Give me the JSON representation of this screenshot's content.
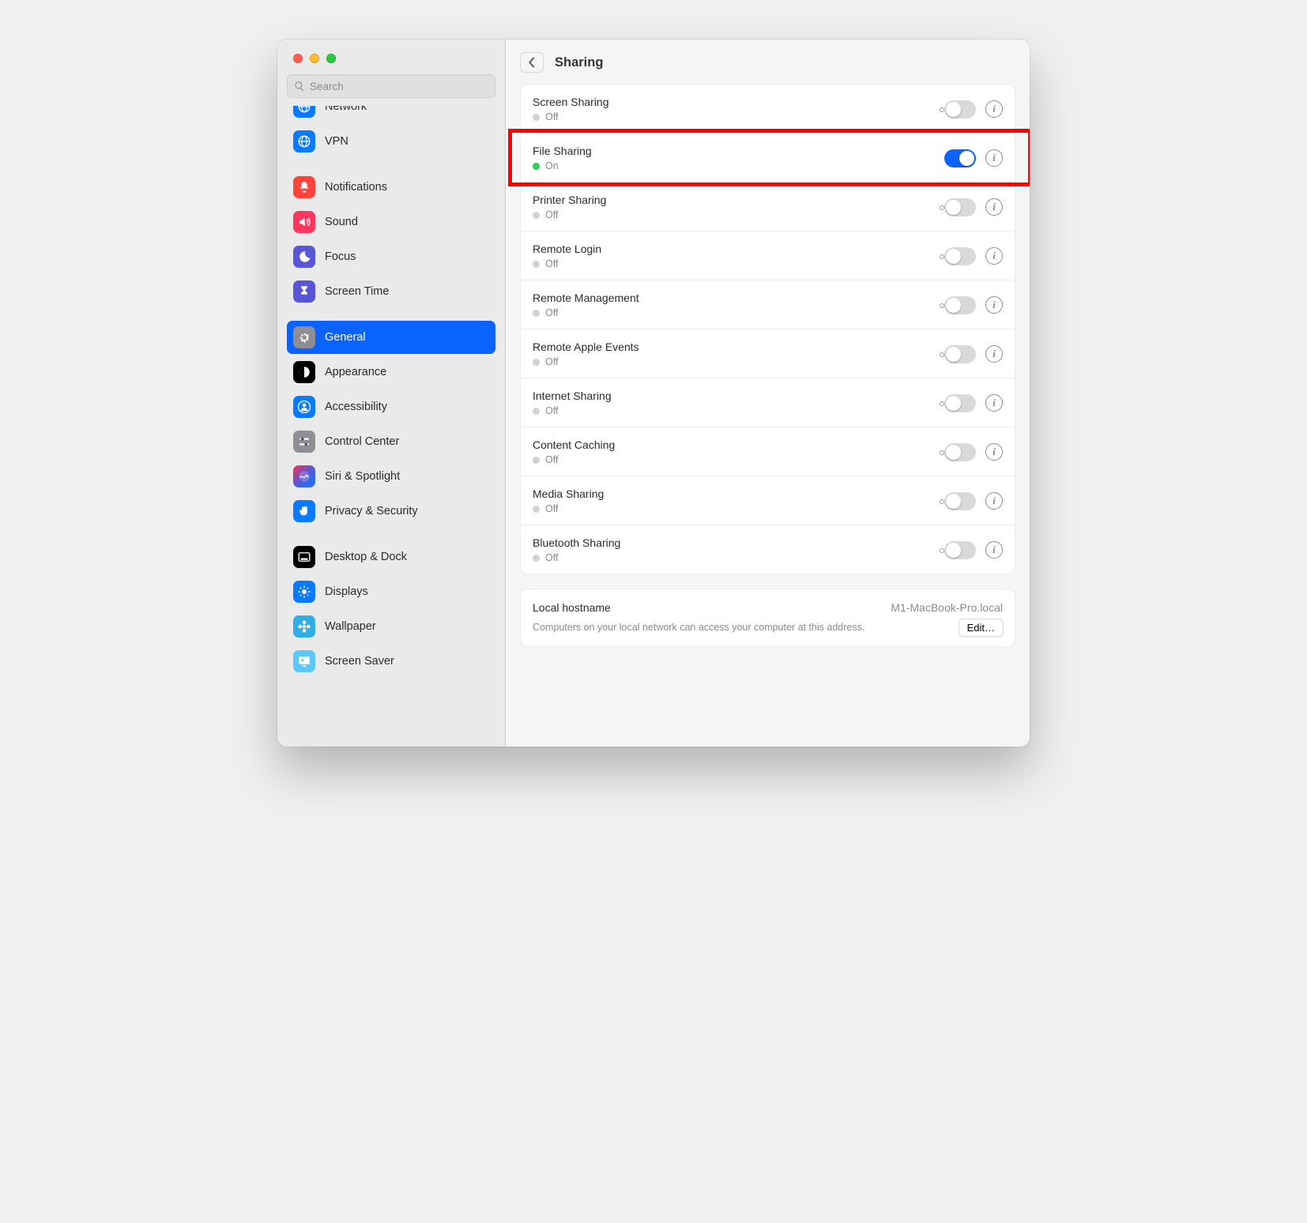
{
  "header": {
    "title": "Sharing"
  },
  "search": {
    "placeholder": "Search"
  },
  "sidebar": {
    "items": [
      {
        "label": "Network",
        "icon": "globe-grid-icon",
        "bg": "bg-blue",
        "partial": true
      },
      {
        "label": "VPN",
        "icon": "globe-grid-icon",
        "bg": "bg-blue2"
      },
      {
        "gap": true
      },
      {
        "label": "Notifications",
        "icon": "bell-icon",
        "bg": "bg-red"
      },
      {
        "label": "Sound",
        "icon": "sound-icon",
        "bg": "bg-pink"
      },
      {
        "label": "Focus",
        "icon": "moon-icon",
        "bg": "bg-indigo"
      },
      {
        "label": "Screen Time",
        "icon": "hourglass-icon",
        "bg": "bg-indigo"
      },
      {
        "gap": true
      },
      {
        "label": "General",
        "icon": "gear-icon",
        "bg": "bg-grey",
        "selected": true
      },
      {
        "label": "Appearance",
        "icon": "contrast-icon",
        "bg": "bg-black"
      },
      {
        "label": "Accessibility",
        "icon": "person-icon",
        "bg": "bg-blue"
      },
      {
        "label": "Control Center",
        "icon": "sliders-icon",
        "bg": "bg-grey"
      },
      {
        "label": "Siri & Spotlight",
        "icon": "siri-icon",
        "bg": "bg-siri"
      },
      {
        "label": "Privacy & Security",
        "icon": "hand-icon",
        "bg": "bg-blue"
      },
      {
        "gap": true
      },
      {
        "label": "Desktop & Dock",
        "icon": "dock-icon",
        "bg": "bg-black"
      },
      {
        "label": "Displays",
        "icon": "sun-icon",
        "bg": "bg-blue"
      },
      {
        "label": "Wallpaper",
        "icon": "flower-icon",
        "bg": "bg-teal"
      },
      {
        "label": "Screen Saver",
        "icon": "screensaver-icon",
        "bg": "bg-cyan"
      }
    ]
  },
  "sharing": {
    "items": [
      {
        "title": "Screen Sharing",
        "status": "Off",
        "on": false
      },
      {
        "title": "File Sharing",
        "status": "On",
        "on": true,
        "highlight": true
      },
      {
        "title": "Printer Sharing",
        "status": "Off",
        "on": false
      },
      {
        "title": "Remote Login",
        "status": "Off",
        "on": false
      },
      {
        "title": "Remote Management",
        "status": "Off",
        "on": false
      },
      {
        "title": "Remote Apple Events",
        "status": "Off",
        "on": false
      },
      {
        "title": "Internet Sharing",
        "status": "Off",
        "on": false
      },
      {
        "title": "Content Caching",
        "status": "Off",
        "on": false
      },
      {
        "title": "Media Sharing",
        "status": "Off",
        "on": false
      },
      {
        "title": "Bluetooth Sharing",
        "status": "Off",
        "on": false
      }
    ]
  },
  "hostname": {
    "label": "Local hostname",
    "value": "M1-MacBook-Pro.local",
    "help": "Computers on your local network can access your computer at this address.",
    "edit": "Edit…"
  }
}
